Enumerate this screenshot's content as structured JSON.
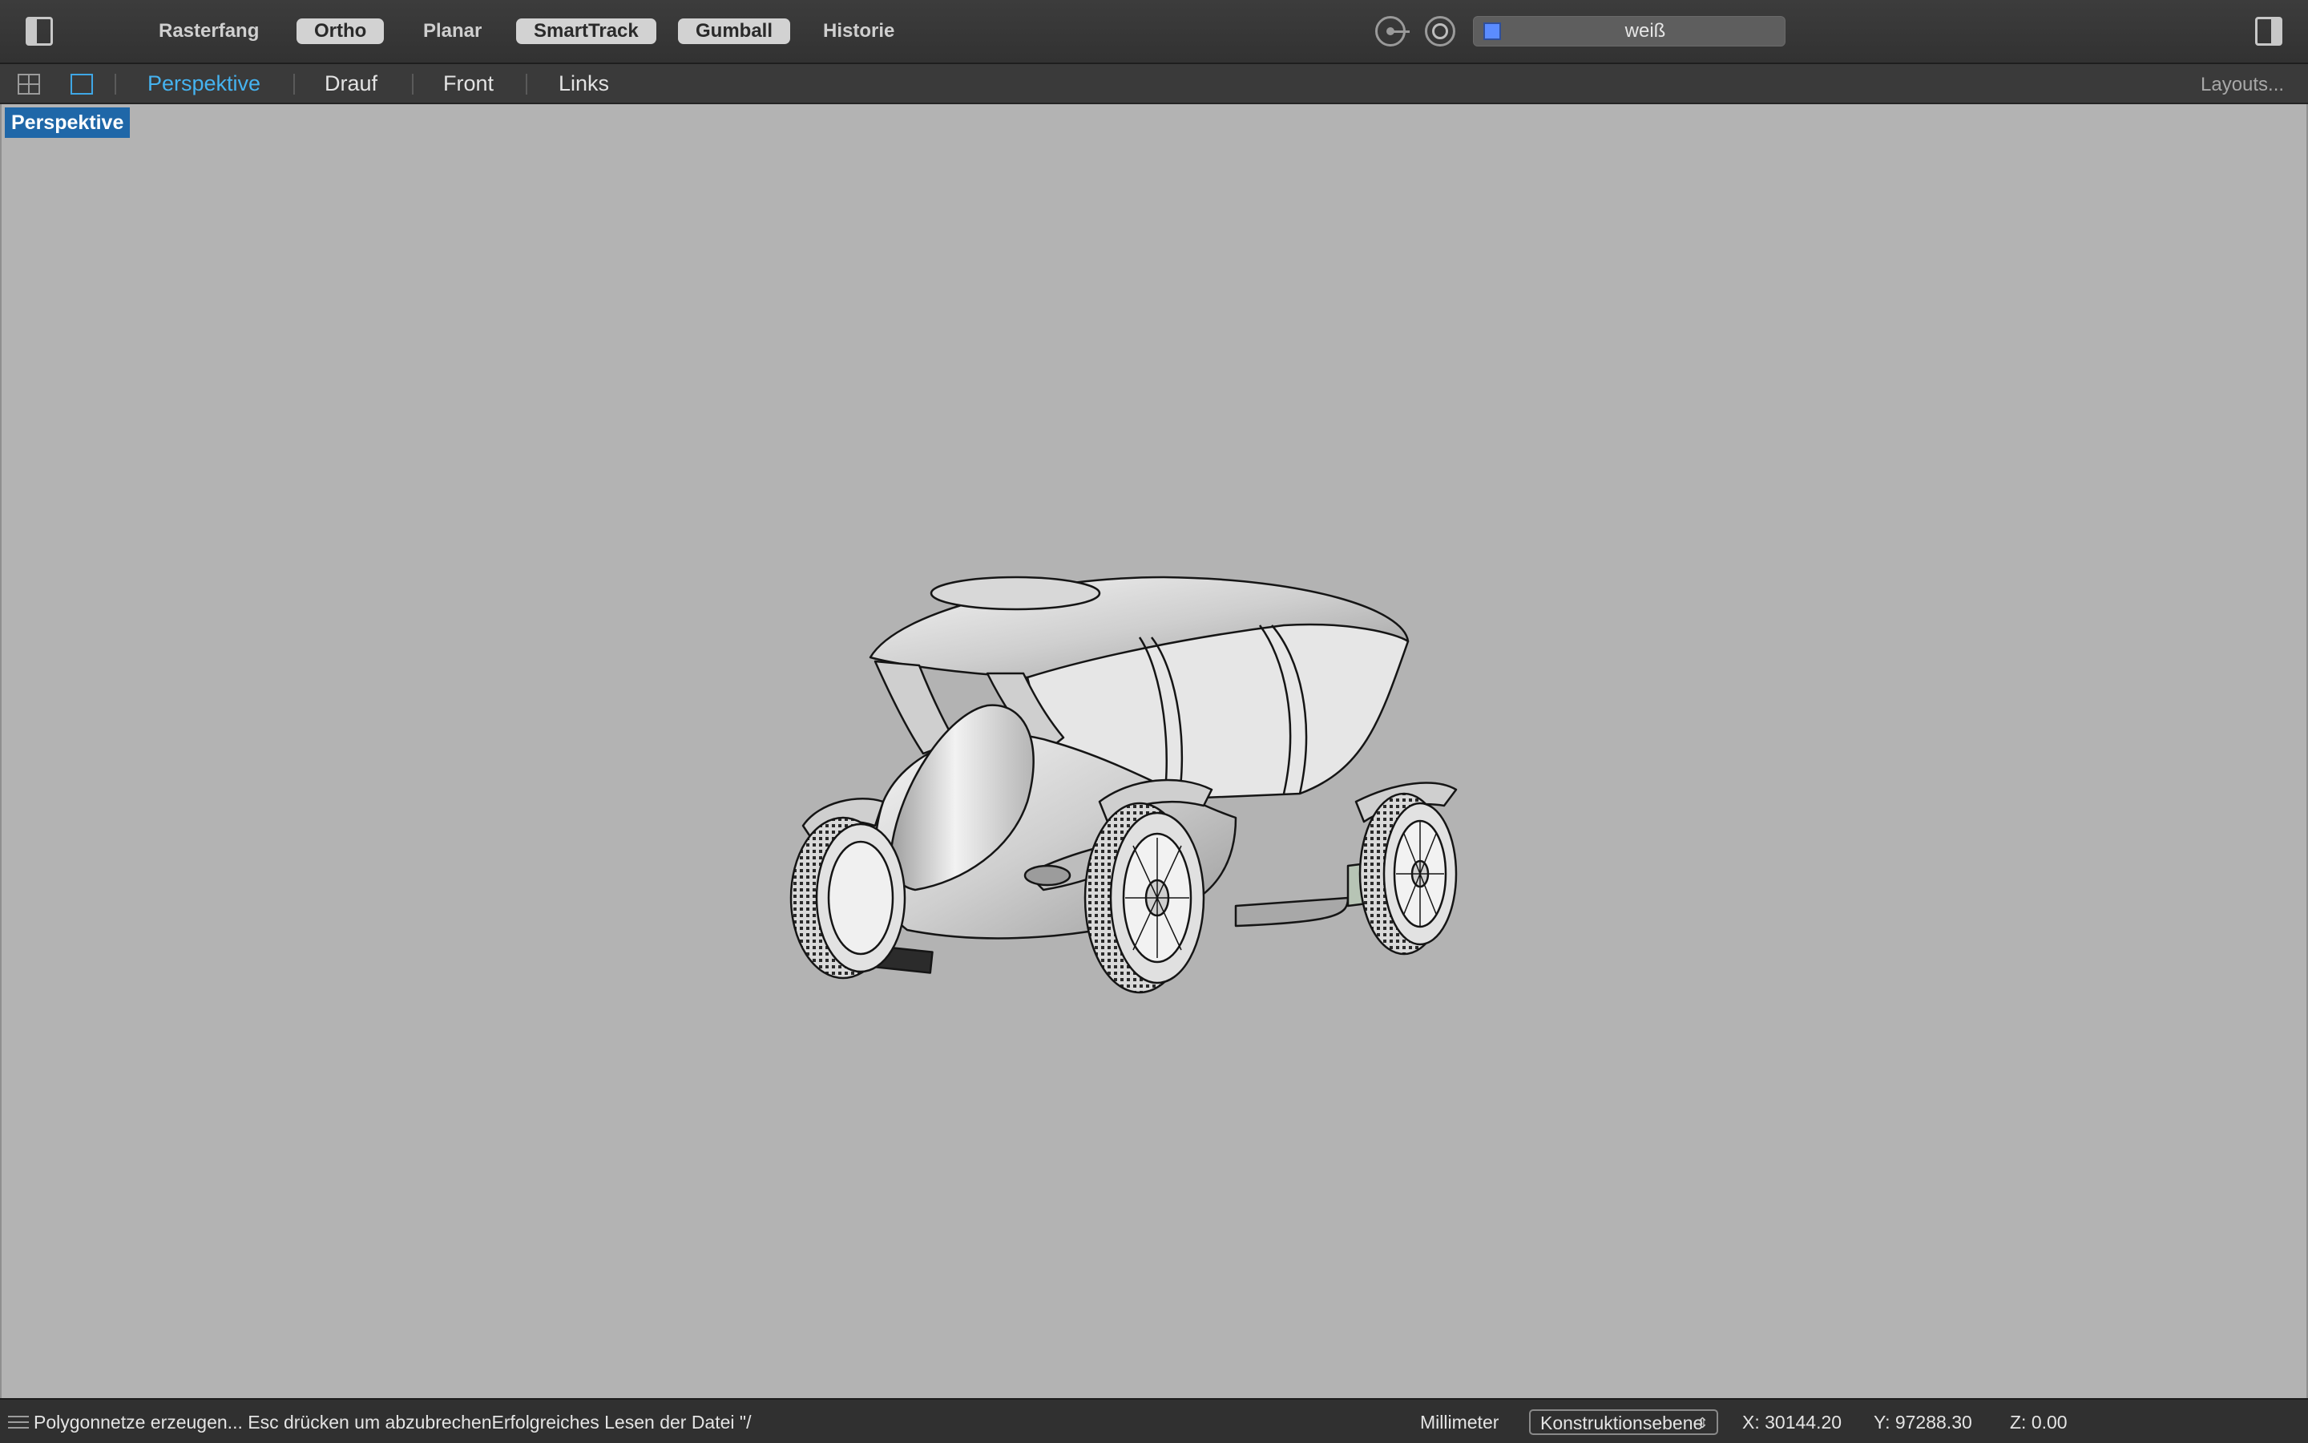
{
  "toolbar": {
    "modes": [
      {
        "label": "Rasterfang",
        "active": false
      },
      {
        "label": "Ortho",
        "active": true
      },
      {
        "label": "Planar",
        "active": false
      },
      {
        "label": "SmartTrack",
        "active": true
      },
      {
        "label": "Gumball",
        "active": true
      },
      {
        "label": "Historie",
        "active": false
      }
    ],
    "icons": [
      "osnap-icon",
      "record-history-icon"
    ],
    "layer": {
      "name": "weiß",
      "swatch_color": "#5b8cff"
    }
  },
  "viewport_tabs": {
    "tabs": [
      {
        "label": "Perspektive",
        "active": true
      },
      {
        "label": "Drauf",
        "active": false
      },
      {
        "label": "Front",
        "active": false
      },
      {
        "label": "Links",
        "active": false
      }
    ],
    "layouts_label": "Layouts..."
  },
  "viewport": {
    "label": "Perspektive",
    "background": "#b3b3b3",
    "model_description_icon": "car-model"
  },
  "statusbar": {
    "message": "Polygonnetze erzeugen... Esc drücken um abzubrechenErfolgreiches Lesen der Datei \"/",
    "units": "Millimeter",
    "cplane": "Konstruktionsebene",
    "x": "X: 30144.20",
    "y": "Y: 97288.30",
    "z": "Z: 0.00"
  }
}
